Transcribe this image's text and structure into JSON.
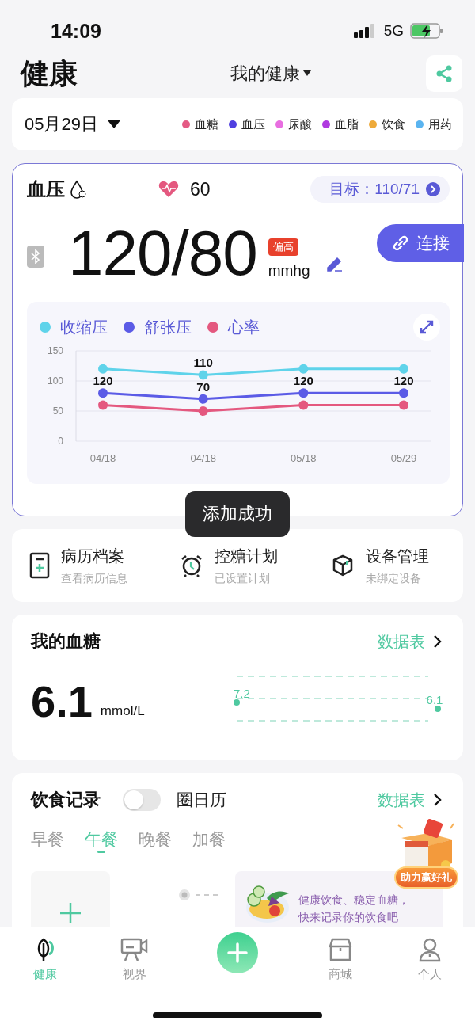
{
  "status_bar": {
    "time": "14:09",
    "network": "5G"
  },
  "header": {
    "title": "健康",
    "switcher": "我的健康"
  },
  "date_bar": {
    "date": "05月29日",
    "legend": [
      {
        "label": "血糖",
        "color": "#e45a84"
      },
      {
        "label": "血压",
        "color": "#4f3fe0"
      },
      {
        "label": "尿酸",
        "color": "#e86ee0"
      },
      {
        "label": "血脂",
        "color": "#b03ae0"
      },
      {
        "label": "饮食",
        "color": "#eeaa3a"
      },
      {
        "label": "用药",
        "color": "#5ab4f0"
      }
    ]
  },
  "blood_pressure": {
    "title": "血压",
    "heart_rate": "60",
    "target": "目标：110/71",
    "reading": "120/80",
    "badge": "偏高",
    "unit": "mmhg",
    "connect_button": "连接",
    "chart_data": {
      "type": "line",
      "categories": [
        "04/18",
        "04/18",
        "05/18",
        "05/29"
      ],
      "ylim": [
        0,
        150
      ],
      "yticks": [
        0,
        50,
        100,
        150
      ],
      "series": [
        {
          "name": "收缩压",
          "color": "#5fd3ea",
          "marker": "circle",
          "values": [
            120,
            110,
            120,
            120
          ]
        },
        {
          "name": "舒张压",
          "color": "#5b5be6",
          "marker": "circle",
          "values": [
            80,
            70,
            80,
            80
          ]
        },
        {
          "name": "心率",
          "color": "#e4587f",
          "marker": "circle",
          "values": [
            60,
            50,
            60,
            60
          ]
        }
      ]
    },
    "point_labels": [
      {
        "texts": [
          "120"
        ]
      },
      {
        "texts": [
          "110",
          "70"
        ]
      },
      {
        "texts": [
          "120"
        ]
      },
      {
        "texts": [
          "120"
        ]
      }
    ]
  },
  "toast": "添加成功",
  "shortcuts": [
    {
      "title": "病历档案",
      "subtitle": "查看病历信息"
    },
    {
      "title": "控糖计划",
      "subtitle": "已设置计划"
    },
    {
      "title": "设备管理",
      "subtitle": "未绑定设备"
    }
  ],
  "blood_sugar": {
    "title": "我的血糖",
    "link": "数据表",
    "value": "6.1",
    "unit": "mmol/L",
    "points": [
      {
        "label": "7.2"
      },
      {
        "label": "6.1"
      }
    ]
  },
  "diet": {
    "title": "饮食记录",
    "calendar_toggle": {
      "label": "圈日历",
      "on": false
    },
    "link": "数据表",
    "meals": [
      {
        "label": "早餐",
        "selected": false
      },
      {
        "label": "午餐",
        "selected": true
      },
      {
        "label": "晚餐",
        "selected": false
      },
      {
        "label": "加餐",
        "selected": false
      }
    ],
    "tip_lines": [
      "健康饮食、稳定血糖，",
      "快来记录你的饮食吧"
    ]
  },
  "promo": {
    "label": "助力赢好礼"
  },
  "tab_bar": [
    {
      "kind": "tab",
      "label": "健康",
      "selected": true
    },
    {
      "kind": "tab",
      "label": "视界",
      "selected": false
    },
    {
      "kind": "add"
    },
    {
      "kind": "tab",
      "label": "商城",
      "selected": false
    },
    {
      "kind": "tab",
      "label": "个人",
      "selected": false
    }
  ]
}
